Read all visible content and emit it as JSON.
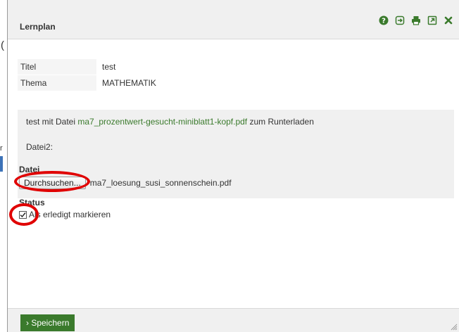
{
  "background": {
    "fragments": [
      "(",
      "r"
    ]
  },
  "dialog": {
    "title": "Lernplan",
    "toolbar_icons": [
      "help-icon",
      "export-icon",
      "print-icon",
      "popout-icon",
      "close-icon"
    ]
  },
  "details": {
    "rows": [
      {
        "key": "Titel",
        "value": "test"
      },
      {
        "key": "Thema",
        "value": "MATHEMATIK"
      }
    ]
  },
  "info": {
    "prefix": "test mit Datei ",
    "file_link": "ma7_prozentwert-gesucht-miniblatt1-kopf.pdf",
    "suffix": " zum Runterladen",
    "datei2_label": "Datei2:"
  },
  "file_section": {
    "label": "Datei",
    "browse_label": "Durchsuchen...",
    "selected_file": "ma7_loesung_susi_sonnenschein.pdf"
  },
  "status_section": {
    "label": "Status",
    "checkbox_label": "Als erledigt markieren",
    "checked": true
  },
  "footer": {
    "save_label": "› Speichern"
  },
  "colors": {
    "accent_green": "#3a7a2c",
    "highlight_red": "#e00000",
    "bg_blue_bar": "#3d73b8"
  }
}
